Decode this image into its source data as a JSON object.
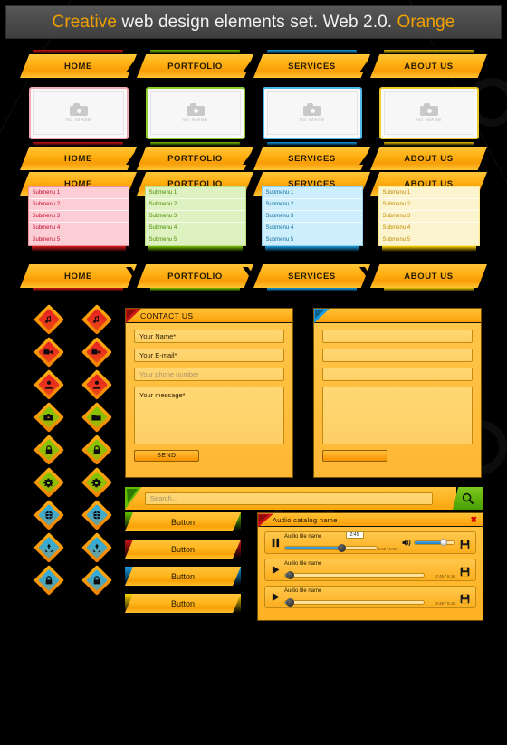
{
  "header": {
    "title_part1": "Creative",
    "title_part2": " web design elements set. Web 2.0. ",
    "title_part3": "Orange",
    "accent_color": "#f0a000"
  },
  "colors": {
    "orange": "#ffb012",
    "red": "#d81a1a",
    "green": "#79c000",
    "blue": "#1b9ce0",
    "yellow": "#ffd400"
  },
  "nav": {
    "items": [
      {
        "label": "HOME",
        "color": "#cf1616"
      },
      {
        "label": "PORTFOLIO",
        "color": "#79c000"
      },
      {
        "label": "SERVICES",
        "color": "#1b9ce0"
      },
      {
        "label": "ABOUT US",
        "color": "#e8c400"
      }
    ]
  },
  "frames": [
    {
      "no_image_label": "NO IMAGE",
      "border": "#f3a8b5"
    },
    {
      "no_image_label": "NO IMAGE",
      "border": "#8dd02c"
    },
    {
      "no_image_label": "NO IMAGE",
      "border": "#4fb9e8"
    },
    {
      "no_image_label": "NO IMAGE",
      "border": "#eec92a"
    }
  ],
  "submenus": [
    {
      "theme": "red",
      "bg": "#fccdd4",
      "text": "#c01030",
      "foot": "#d81a1a",
      "items": [
        "Submenu 1",
        "Submenu 2",
        "Submenu 3",
        "Submenu 4",
        "Submenu 5"
      ]
    },
    {
      "theme": "green",
      "bg": "#ddf2c0",
      "text": "#4f8a00",
      "foot": "#79c000",
      "items": [
        "Submenu 1",
        "Submenu 2",
        "Submenu 3",
        "Submenu 4",
        "Submenu 5"
      ]
    },
    {
      "theme": "blue",
      "bg": "#cdeefc",
      "text": "#0d6c9e",
      "foot": "#1b9ce0",
      "items": [
        "Submenu 1",
        "Submenu 2",
        "Submenu 3",
        "Submenu 4",
        "Submenu 5"
      ]
    },
    {
      "theme": "yellow",
      "bg": "#fbf4cf",
      "text": "#c28a00",
      "foot": "#ffd400",
      "items": [
        "Submenu 1",
        "Submenu 2",
        "Submenu 3",
        "Submenu 4",
        "Submenu 5"
      ]
    }
  ],
  "icon_grid": {
    "rows": [
      {
        "color": "#e62121",
        "icons": [
          "music-note-icon",
          "music-note-icon"
        ],
        "glyphs": [
          "♫",
          "♪"
        ]
      },
      {
        "color": "#e62121",
        "icons": [
          "video-camera-icon",
          "video-camera-icon"
        ],
        "glyphs": [
          "▶",
          "▶"
        ]
      },
      {
        "color": "#e62121",
        "icons": [
          "user-icon",
          "user-icon"
        ],
        "glyphs": [
          "♟",
          "♟"
        ]
      },
      {
        "color": "#7fc400",
        "icons": [
          "briefcase-icon",
          "folder-icon"
        ],
        "glyphs": [
          "▬",
          "▬"
        ]
      },
      {
        "color": "#7fc400",
        "icons": [
          "lock-icon",
          "lock-icon"
        ],
        "glyphs": [
          "⚿",
          "⚿"
        ]
      },
      {
        "color": "#7fc400",
        "icons": [
          "gear-icon",
          "gear-icon"
        ],
        "glyphs": [
          "⚙",
          "⚙"
        ]
      },
      {
        "color": "#29abe2",
        "icons": [
          "globe-icon",
          "globe-icon"
        ],
        "glyphs": [
          "●",
          "●"
        ]
      },
      {
        "color": "#29abe2",
        "icons": [
          "recycle-icon",
          "recycle-icon"
        ],
        "glyphs": [
          "♻",
          "♻"
        ]
      },
      {
        "color": "#29abe2",
        "icons": [
          "lock-icon",
          "lock-icon"
        ],
        "glyphs": [
          "⚿",
          "⚿"
        ]
      }
    ]
  },
  "contact_form": {
    "title": "CONTACT US",
    "corner_color": "#cf1616",
    "name_value": "Your Name*",
    "email_value": "Your E-mail*",
    "phone_placeholder": "Your phone number",
    "message_value": "Your message*",
    "send_label": "SEND"
  },
  "blank_form": {
    "title": "",
    "corner_color": "#1b9ce0",
    "name_value": "",
    "email_value": "",
    "phone_placeholder": "",
    "message_value": "",
    "send_label": ""
  },
  "search": {
    "placeholder": "Search...",
    "icon": "search-icon",
    "button_color": "#5cb000"
  },
  "buttons": [
    {
      "label": "Button",
      "color": "#62bd00"
    },
    {
      "label": "Button",
      "color": "#cf1616"
    },
    {
      "label": "Button",
      "color": "#1b9ce0"
    },
    {
      "label": "Button",
      "color": "#ffd400"
    }
  ],
  "audio_player": {
    "catalog_title": "Audio catalog name",
    "close_label": "✖",
    "tracks": [
      {
        "state": "playing",
        "control_icon": "pause-icon",
        "name": "Audio file name",
        "tooltip_time": "2:45",
        "time_text": "2:45 / 5:10",
        "progress_percent": 62,
        "volume_percent": 72,
        "save_icon": "save-icon",
        "has_volume": true
      },
      {
        "state": "paused",
        "control_icon": "play-icon",
        "name": "Audio file name",
        "tooltip_time": "",
        "time_text": "2:45 / 5:10",
        "progress_percent": 3,
        "volume_percent": 0,
        "save_icon": "save-icon",
        "has_volume": false
      },
      {
        "state": "paused",
        "control_icon": "play-icon",
        "name": "Audio file name",
        "tooltip_time": "",
        "time_text": "2:45 / 5:10",
        "progress_percent": 3,
        "volume_percent": 0,
        "save_icon": "save-icon",
        "has_volume": false
      }
    ]
  }
}
